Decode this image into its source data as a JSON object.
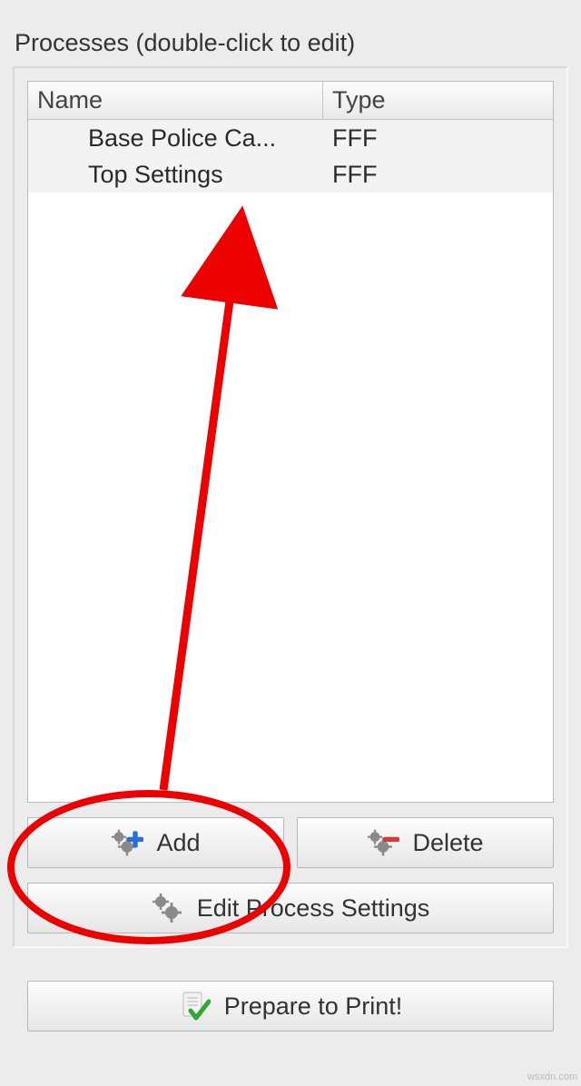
{
  "section_label": "Processes (double-click to edit)",
  "table": {
    "columns": {
      "name": "Name",
      "type": "Type"
    },
    "rows": [
      {
        "name": "Base Police Ca...",
        "type": "FFF"
      },
      {
        "name": "Top Settings",
        "type": "FFF"
      }
    ]
  },
  "buttons": {
    "add": "Add",
    "delete": "Delete",
    "edit": "Edit Process Settings",
    "prepare": "Prepare to Print!"
  },
  "watermark": "wsxdn.com"
}
